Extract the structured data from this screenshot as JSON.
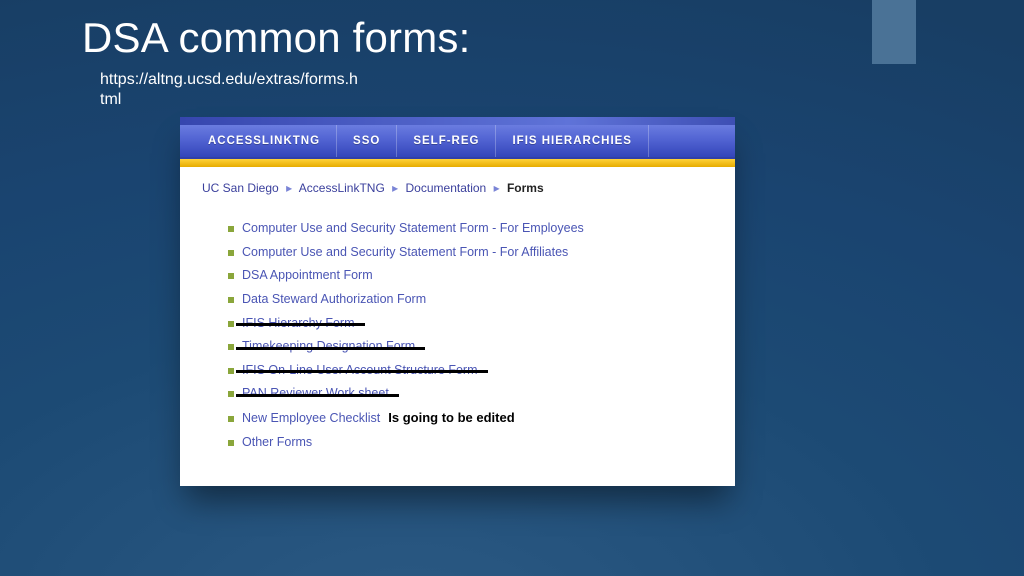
{
  "title": "DSA common forms:",
  "url": "https://altng.ucsd.edu/extras/forms.html",
  "nav": {
    "items": [
      "ACCESSLINKTNG",
      "SSO",
      "SELF-REG",
      "IFIS HIERARCHIES"
    ]
  },
  "breadcrumb": {
    "parts": [
      "UC San Diego",
      "AccessLinkTNG",
      "Documentation"
    ],
    "current": "Forms",
    "sep": "▸"
  },
  "forms": [
    {
      "label": "Computer Use and Security Statement Form - For Employees",
      "struck": false
    },
    {
      "label": "Computer Use and Security Statement Form - For Affiliates",
      "struck": false
    },
    {
      "label": "DSA Appointment Form",
      "struck": false
    },
    {
      "label": "Data Steward Authorization Form",
      "struck": false
    },
    {
      "label": "IFIS Hierarchy Form",
      "struck": true
    },
    {
      "label": "Timekeeping Designation Form",
      "struck": true
    },
    {
      "label": "IFIS On-Line User Account Structure Form",
      "struck": true
    },
    {
      "label": "PAN Reviewer Work sheet",
      "struck": true
    },
    {
      "label": "New Employee Checklist",
      "struck": false,
      "note": "Is going to be edited"
    },
    {
      "label": "Other Forms",
      "struck": false
    }
  ]
}
